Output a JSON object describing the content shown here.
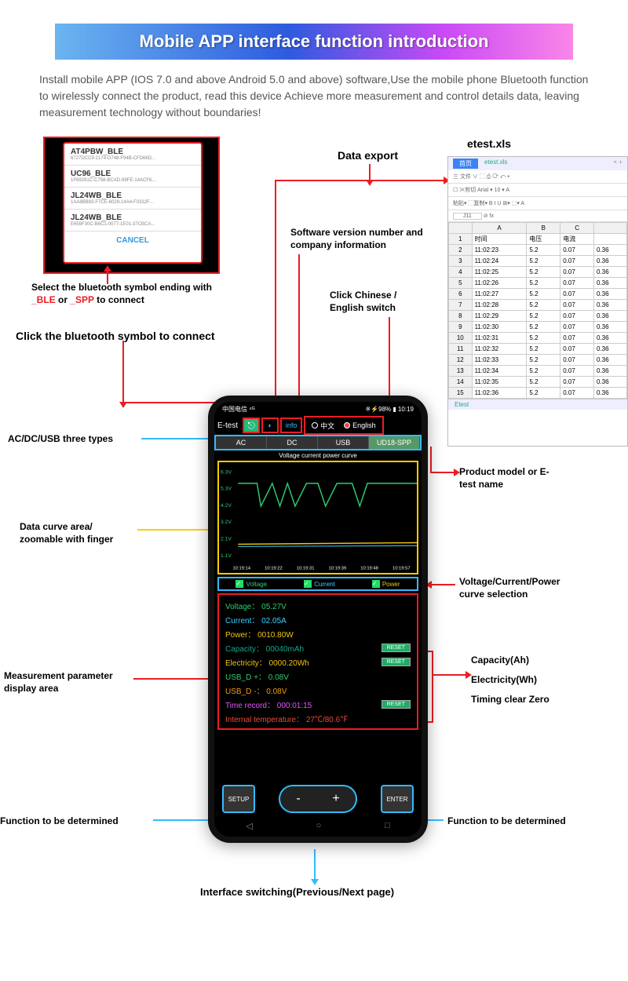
{
  "banner_title": "Mobile APP interface function introduction",
  "intro": "Install mobile APP (IOS 7.0 and above Android 5.0 and above) software,Use the mobile phone Bluetooth function to wirelessly connect the product, read this device Achieve more measurement and control details data, leaving measurement technology without boundaries!",
  "bt": {
    "items": [
      {
        "name": "AT4PBW_BLE",
        "uuid": "6727DCC9-2174-D748-F94B-CFD66D..."
      },
      {
        "name": "UC96_BLE",
        "uuid": "1F69261C-C758-BCAD-99FE-14ACF6..."
      },
      {
        "name": "JL24WB_BLE",
        "uuid": "1AA8BB83-F7CE-6029-14A4-F0332F..."
      },
      {
        "name": "JL24WB_BLE",
        "uuid": "E659F30C-B6C1-0077-1E01-37CBCA..."
      }
    ],
    "cancel": "CANCEL"
  },
  "labels": {
    "select_bt": "Select the bluetooth symbol ending with ",
    "select_bt_suffix": " to connect",
    "ble": "_BLE",
    "spp": "_SPP",
    "or": " or ",
    "click_bt": "Click the bluetooth symbol to connect",
    "data_export": "Data export",
    "sw_version": "Software version number and company information",
    "lang_switch": "Click Chinese / English switch",
    "three_types": "AC/DC/USB three types",
    "curve_area": "Data curve area/ zoomable with finger",
    "param_area": "Measurement parameter display area",
    "tbd1": "Function to be determined",
    "tbd2": "Function to be determined",
    "switching": "Interface switching(Previous/Next page)",
    "model": "Product model or E-test name",
    "curve_sel": "Voltage/Current/Power curve selection",
    "resets": "Capacity(Ah)\nElectricity(Wh)\nTiming clear Zero",
    "cap": "Capacity(Ah)",
    "elec": "Electricity(Wh)",
    "timing": "Timing clear Zero"
  },
  "phone": {
    "app_name": "E-test",
    "status": {
      "left": "中国电信 ⁴ᴳ",
      "right": "※⚡98% ▮ 10:19"
    },
    "info": "info",
    "lang_cn": "中文",
    "lang_en": "English",
    "tabs": [
      "AC",
      "DC",
      "USB",
      "UD18-SPP"
    ],
    "chart_title": "Voltage current power curve",
    "y_left": [
      "6.3V",
      "5.3V",
      "4.2V",
      "3.2V",
      "2.1V",
      "1.1V"
    ],
    "x_ticks": [
      "10:19:14",
      "10:19:22",
      "10:19:31",
      "10:19:39",
      "10:19:48",
      "10:19:57"
    ],
    "legend": [
      "Voltage",
      "Current",
      "Power"
    ],
    "params": [
      {
        "label": "Voltage：",
        "value": "05.27V",
        "color": "#2ecc71"
      },
      {
        "label": "Current：",
        "value": "02.05A",
        "color": "#3bd1ff"
      },
      {
        "label": "Power：",
        "value": "0010.80W",
        "color": "#f1c40f"
      },
      {
        "label": "Capacity：",
        "value": "00040mAh",
        "color": "#17a589",
        "reset": true
      },
      {
        "label": "Electricity：",
        "value": "0000.20Wh",
        "color": "#f1c40f",
        "reset": true
      },
      {
        "label": "USB_D +：",
        "value": "0.08V",
        "color": "#2ecc71"
      },
      {
        "label": "USB_D -：",
        "value": "0.08V",
        "color": "#f39c12"
      },
      {
        "label": "Time record：",
        "value": "000:01:15",
        "color": "#e056fd",
        "reset": true
      },
      {
        "label": "Internal temperature：",
        "value": "27℃/80.6℉",
        "color": "#e74c3c"
      }
    ],
    "reset": "RESET",
    "setup": "SETUP",
    "enter": "ENTER"
  },
  "xls": {
    "filename": "etest.xls",
    "pg": "首页",
    "tab": "etest.xls",
    "menu": "三 文件 ∨  ⬚ ⎙ ⟳ ↶ ▾",
    "tool1": "☐ ✂剪切            Arial           ▾ 10 ▾ A",
    "tool2": "粘贴▾ ⬚复制▾      B  I  U  ⊞▾  ⬚▾   A",
    "cell": "J11",
    "fx": "⊘  fx",
    "headers": [
      "",
      "A",
      "B",
      "C",
      ""
    ],
    "row1": [
      "1",
      "时间",
      "电压",
      "电流",
      ""
    ],
    "rows": [
      [
        "2",
        "11:02:23",
        "5.2",
        "0.07",
        "0.36"
      ],
      [
        "3",
        "11:02:24",
        "5.2",
        "0.07",
        "0.36"
      ],
      [
        "4",
        "11:02:25",
        "5.2",
        "0.07",
        "0.36"
      ],
      [
        "5",
        "11:02:26",
        "5.2",
        "0.07",
        "0.36"
      ],
      [
        "6",
        "11:02:27",
        "5.2",
        "0.07",
        "0.36"
      ],
      [
        "7",
        "11:02:28",
        "5.2",
        "0.07",
        "0.36"
      ],
      [
        "8",
        "11:02:29",
        "5.2",
        "0.07",
        "0.36"
      ],
      [
        "9",
        "11:02:30",
        "5.2",
        "0.07",
        "0.36"
      ],
      [
        "10",
        "11:02:31",
        "5.2",
        "0.07",
        "0.36"
      ],
      [
        "11",
        "11:02:32",
        "5.2",
        "0.07",
        "0.36"
      ],
      [
        "12",
        "11:02:33",
        "5.2",
        "0.07",
        "0.36"
      ],
      [
        "13",
        "11:02:34",
        "5.2",
        "0.07",
        "0.36"
      ],
      [
        "14",
        "11:02:35",
        "5.2",
        "0.07",
        "0.36"
      ],
      [
        "15",
        "11:02:36",
        "5.2",
        "0.07",
        "0.36"
      ]
    ],
    "sheet": "Etest"
  }
}
